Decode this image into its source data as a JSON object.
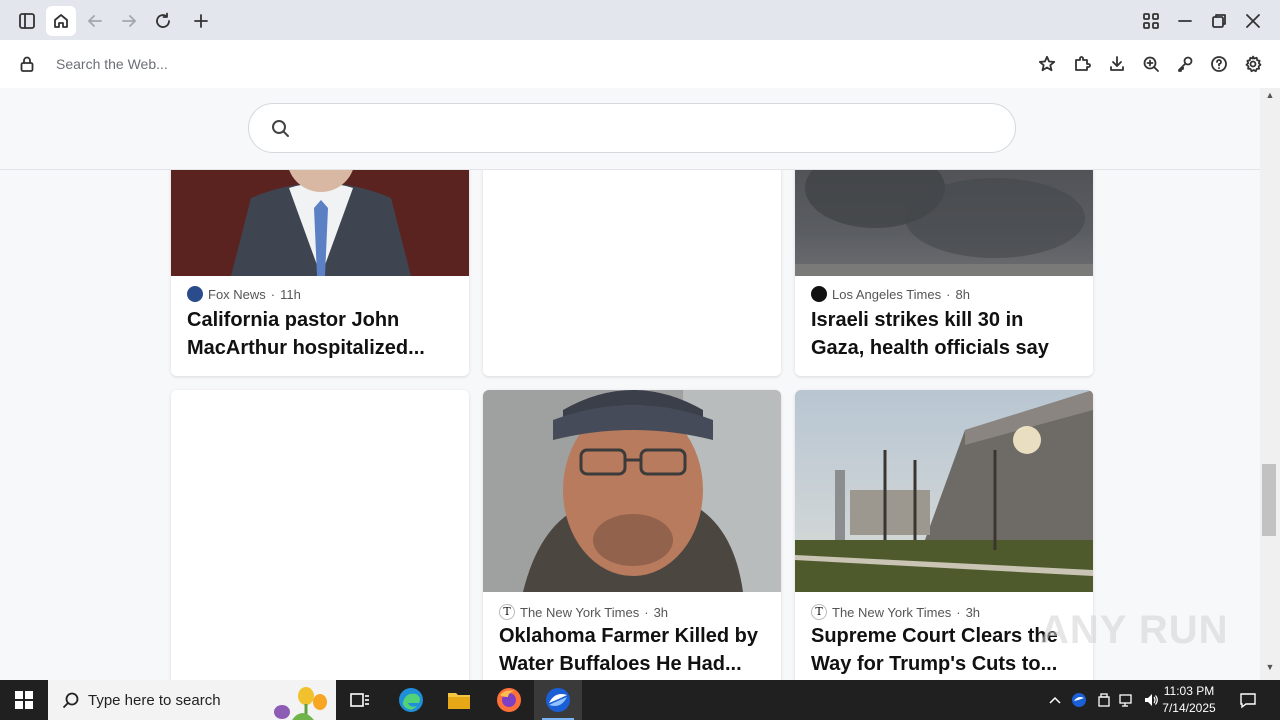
{
  "browser": {
    "address_placeholder": "Search the Web...",
    "toolbar_icons": [
      "sidebar-icon",
      "home-icon",
      "back-icon",
      "forward-icon",
      "reload-icon",
      "new-tab-icon"
    ],
    "right_icons": [
      "bookmark-star-icon",
      "extensions-icon",
      "download-icon",
      "zoom-icon",
      "key-icon",
      "help-icon",
      "settings-icon"
    ]
  },
  "page": {
    "search_placeholder": ""
  },
  "cards": [
    {
      "source": "Fox News",
      "time": "11h",
      "headline": "California pastor John MacArthur hospitalized...",
      "image": "man-in-suit-photo"
    },
    {
      "source": "",
      "time": "",
      "headline": "",
      "image": ""
    },
    {
      "source": "Los Angeles Times",
      "time": "8h",
      "headline": "Israeli strikes kill 30 in Gaza, health officials say",
      "image": "smoke-photo"
    },
    {
      "source": "",
      "time": "",
      "headline": "",
      "image": ""
    },
    {
      "source": "The New York Times",
      "time": "3h",
      "headline": "Oklahoma Farmer Killed by Water Buffaloes He Had...",
      "image": "man-selfie-photo"
    },
    {
      "source": "The New York Times",
      "time": "3h",
      "headline": "Supreme Court Clears the Way for Trump's Cuts to...",
      "image": "building-trees-photo"
    }
  ],
  "taskbar": {
    "search_text": "Type here to search",
    "time": "11:03 PM",
    "date": "7/14/2025"
  },
  "watermark": "ANY RUN",
  "colors": {
    "titlebar": "#e3e6ec",
    "taskbar": "#202020",
    "accent": "#0078d4"
  }
}
